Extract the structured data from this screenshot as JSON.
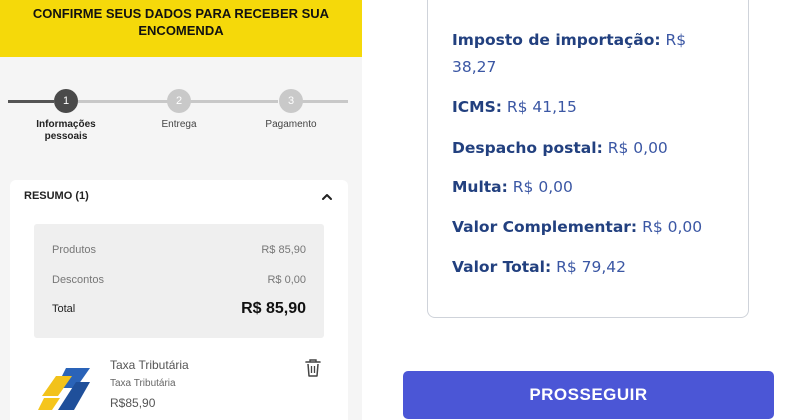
{
  "banner": {
    "text": "CONFIRME SEUS DADOS PARA RECEBER SUA ENCOMENDA"
  },
  "stepper": {
    "steps": [
      {
        "number": "1",
        "label": "Informações pessoais",
        "state": "active"
      },
      {
        "number": "2",
        "label": "Entrega",
        "state": "inactive"
      },
      {
        "number": "3",
        "label": "Pagamento",
        "state": "inactive"
      }
    ]
  },
  "resumo": {
    "header": "RESUMO (1)",
    "rows": [
      {
        "label": "Produtos",
        "value": "R$ 85,90"
      },
      {
        "label": "Descontos",
        "value": "R$ 0,00"
      }
    ],
    "total": {
      "label": "Total",
      "value": "R$ 85,90"
    },
    "product": {
      "name": "Taxa Tributária",
      "subtitle": "Taxa Tributária",
      "price": "R$85,90"
    }
  },
  "taxes": [
    {
      "label": "Imposto de importação:",
      "value": "R$ 38,27"
    },
    {
      "label": "ICMS:",
      "value": "R$ 41,15"
    },
    {
      "label": "Despacho postal:",
      "value": "R$ 0,00"
    },
    {
      "label": "Multa:",
      "value": "R$ 0,00"
    },
    {
      "label": "Valor Complementar:",
      "value": "R$ 0,00"
    },
    {
      "label": "Valor Total:",
      "value": "R$ 79,42"
    }
  ],
  "cta": {
    "label": "PROSSEGUIR"
  },
  "colors": {
    "banner": "#f5d90a",
    "accent": "#4b56d6",
    "taxText": "#2b4a9b"
  }
}
